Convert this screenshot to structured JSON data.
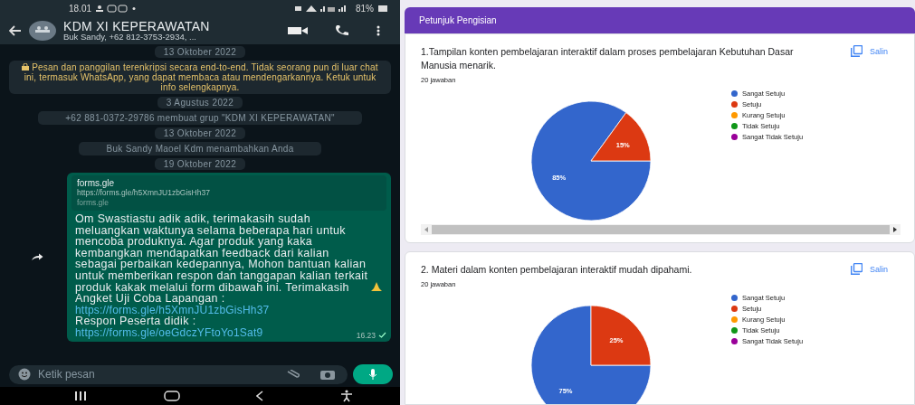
{
  "phone": {
    "status_bar": {
      "time": "18.01",
      "battery": "81%"
    },
    "chat_header": {
      "title": "KDM XI KEPERAWATAN",
      "subtitle": "Buk Sandy, +62 812-3753-2934, ..."
    },
    "messages": [
      {
        "kind": "date",
        "text": "13 Oktober 2022"
      },
      {
        "kind": "notice",
        "text": "Pesan dan panggilan terenkripsi secara end-to-end. Tidak seorang pun di luar chat ini, termasuk WhatsApp, yang dapat membaca atau mendengarkannya. Ketuk untuk info selengkapnya."
      },
      {
        "kind": "date",
        "text": "3 Agustus 2022"
      },
      {
        "kind": "system",
        "text": "+62 881-0372-29786 membuat grup \"KDM XI KEPERAWATAN\""
      },
      {
        "kind": "date",
        "text": "13 Oktober 2022"
      },
      {
        "kind": "system",
        "text": "Buk Sandy Maoel Kdm menambahkan Anda"
      },
      {
        "kind": "date",
        "text": "19 Oktober 2022"
      },
      {
        "kind": "message",
        "forwarded": true,
        "preview": {
          "title": "forms.gle",
          "url": "https://forms.gle/h5XmnJU1zbGisHh37",
          "domain": "forms.gle"
        },
        "body": "Om Swastiastu adik adik, terimakasih sudah meluangkan waktunya selama beberapa hari untuk mencoba produknya. Agar produk yang kaka kembangkan mendapatkan feedback dari kalian sebagai perbaikan kedepannya, Mohon bantuan kalian untuk memberikan respon dan tanggapan kalian terkait produk kakak melalui form dibawah ini. Terimakasih",
        "links": [
          {
            "label": "Angket Uji Coba Lapangan :",
            "url": "https://forms.gle/h5XmnJU1zbGisHh37"
          },
          {
            "label": "Respon Peserta didik :",
            "url": "https://forms.gle/oeGdczYFtoYo1Sat9"
          }
        ],
        "time": "16.23"
      }
    ],
    "composer": {
      "placeholder": "Ketik pesan"
    }
  },
  "forms": {
    "section_title": "Petunjuk Pengisian",
    "questions": [
      {
        "title": "1.Tampilan konten pembelajaran interaktif dalam proses pembelajaran Kebutuhan Dasar Manusia menarik.",
        "copy_label": "Salin",
        "responses": "20 jawaban",
        "chart_data": {
          "type": "pie",
          "categories": [
            "Sangat Setuju",
            "Setuju",
            "Kurang Setuju",
            "Tidak Setuju",
            "Sangat Tidak Setuju"
          ],
          "values": [
            85,
            15,
            0,
            0,
            0
          ],
          "colors": [
            "#3366cc",
            "#dc3912",
            "#ff9900",
            "#109618",
            "#990099"
          ],
          "value_labels": [
            "85%",
            "15%",
            null,
            null,
            null
          ],
          "legend": "right"
        }
      },
      {
        "title": "2. Materi dalam konten pembelajaran interaktif mudah dipahami.",
        "copy_label": "Salin",
        "responses": "20 jawaban",
        "chart_data": {
          "type": "pie",
          "categories": [
            "Sangat Setuju",
            "Setuju",
            "Kurang Setuju",
            "Tidak Setuju",
            "Sangat Tidak Setuju"
          ],
          "values": [
            75,
            25,
            0,
            0,
            0
          ],
          "colors": [
            "#3366cc",
            "#dc3912",
            "#ff9900",
            "#109618",
            "#990099"
          ],
          "value_labels": [
            "75%",
            "25%",
            null,
            null,
            null
          ],
          "legend": "right"
        }
      }
    ]
  }
}
